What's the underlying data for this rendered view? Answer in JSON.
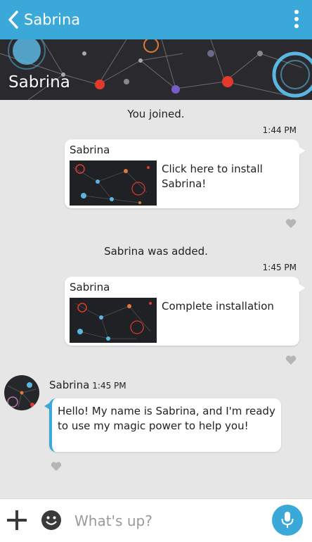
{
  "header": {
    "title": "Sabrina"
  },
  "banner": {
    "title": "Sabrina"
  },
  "messages": [
    {
      "type": "system",
      "text": "You joined."
    },
    {
      "type": "time",
      "text": "1:44 PM"
    },
    {
      "type": "card",
      "sender": "Sabrina",
      "text": "Click here to install Sabrina!"
    },
    {
      "type": "system",
      "text": "Sabrina was added."
    },
    {
      "type": "time",
      "text": "1:45 PM"
    },
    {
      "type": "card",
      "sender": "Sabrina",
      "text": "Complete installation"
    },
    {
      "type": "incoming",
      "sender": "Sabrina",
      "time": "1:45 PM",
      "text": "Hello! My name is Sabrina, and I'm ready to use my magic power to help you!"
    }
  ],
  "composer": {
    "placeholder": "What's up?"
  },
  "colors": {
    "accent": "#3aa8d8",
    "background": "#e6e6e6"
  },
  "icons": [
    "back-icon",
    "more-vert-icon",
    "heart-icon",
    "plus-icon",
    "smiley-icon",
    "mic-icon"
  ]
}
